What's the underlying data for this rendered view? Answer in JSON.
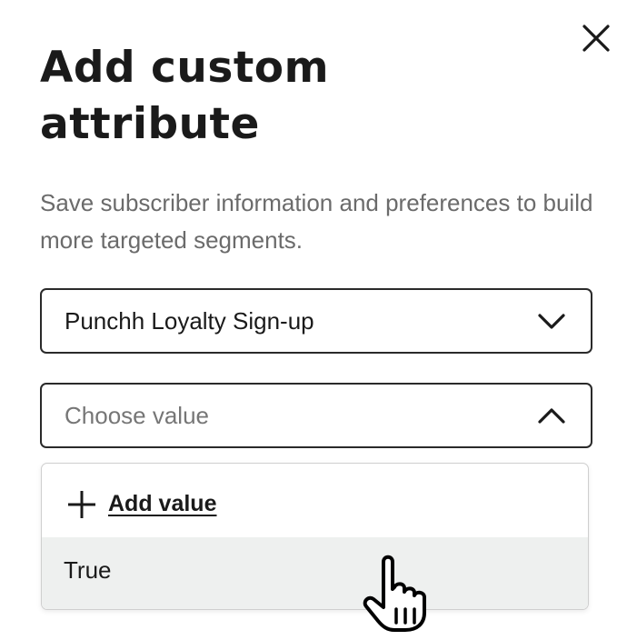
{
  "dialog": {
    "title": "Add custom attribute",
    "description": "Save subscriber information and preferences to build more targeted segments."
  },
  "attribute_select": {
    "value": "Punchh Loyalty Sign-up",
    "state": "collapsed"
  },
  "value_select": {
    "placeholder": "Choose value",
    "state": "expanded"
  },
  "dropdown": {
    "add_value_label": "Add value",
    "options": [
      "True"
    ],
    "hovered_option": "True"
  },
  "colors": {
    "text": "#1a1a1a",
    "muted_text": "#6b6b6b",
    "border": "#2a2a2a",
    "hover_bg": "#eef0ef"
  },
  "icons": {
    "close": "close-icon",
    "attribute_chevron": "chevron-down-icon",
    "value_chevron": "chevron-up-icon",
    "add": "plus-icon",
    "cursor": "hand-pointer-icon"
  }
}
